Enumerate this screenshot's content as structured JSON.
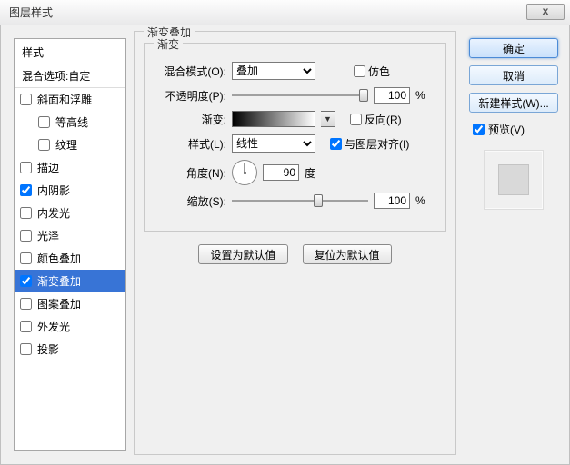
{
  "window": {
    "title": "图层样式",
    "close_glyph": "x"
  },
  "sidebar": {
    "header": "样式",
    "blend_row": "混合选项:自定",
    "items": [
      {
        "label": "斜面和浮雕",
        "checked": false,
        "indent": false
      },
      {
        "label": "等高线",
        "checked": false,
        "indent": true
      },
      {
        "label": "纹理",
        "checked": false,
        "indent": true
      },
      {
        "label": "描边",
        "checked": false,
        "indent": false
      },
      {
        "label": "内阴影",
        "checked": true,
        "indent": false
      },
      {
        "label": "内发光",
        "checked": false,
        "indent": false
      },
      {
        "label": "光泽",
        "checked": false,
        "indent": false
      },
      {
        "label": "颜色叠加",
        "checked": false,
        "indent": false
      },
      {
        "label": "渐变叠加",
        "checked": true,
        "indent": false,
        "selected": true
      },
      {
        "label": "图案叠加",
        "checked": false,
        "indent": false
      },
      {
        "label": "外发光",
        "checked": false,
        "indent": false
      },
      {
        "label": "投影",
        "checked": false,
        "indent": false
      }
    ]
  },
  "main": {
    "group_title": "渐变叠加",
    "inner_title": "渐变",
    "labels": {
      "blend": "混合模式(O):",
      "opacity": "不透明度(P):",
      "grad": "渐变:",
      "style": "样式(L):",
      "angle": "角度(N):",
      "scale": "缩放(S):"
    },
    "blend_value": "叠加",
    "dither_label": "仿色",
    "opacity_value": "100",
    "percent": "%",
    "reverse_label": "反向(R)",
    "style_value": "线性",
    "align_label": "与图层对齐(I)",
    "angle_value": "90",
    "angle_unit": "度",
    "scale_value": "100",
    "buttons": {
      "default": "设置为默认值",
      "reset": "复位为默认值"
    }
  },
  "right": {
    "ok": "确定",
    "cancel": "取消",
    "newstyle": "新建样式(W)...",
    "preview": "预览(V)"
  }
}
